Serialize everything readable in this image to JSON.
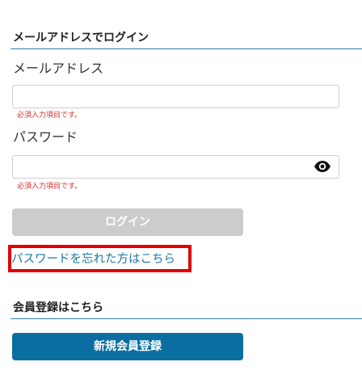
{
  "login_section": {
    "heading": "メールアドレスでログイン",
    "email_label": "メールアドレス",
    "email_value": "",
    "email_error": "必須入力項目です。",
    "password_label": "パスワード",
    "password_value": "",
    "password_error": "必須入力項目です。",
    "password_toggle_icon": "eye-icon",
    "login_button_label": "ログイン",
    "forgot_password_link": "パスワードを忘れた方はこちら"
  },
  "register_section": {
    "heading": "会員登録はこちら",
    "register_button_label": "新規会員登録"
  },
  "colors": {
    "accent": "#0a6fa0",
    "link": "#1b78a8",
    "error": "#d0312d",
    "disabled_button": "#cccccc",
    "highlight": "#e10000"
  }
}
